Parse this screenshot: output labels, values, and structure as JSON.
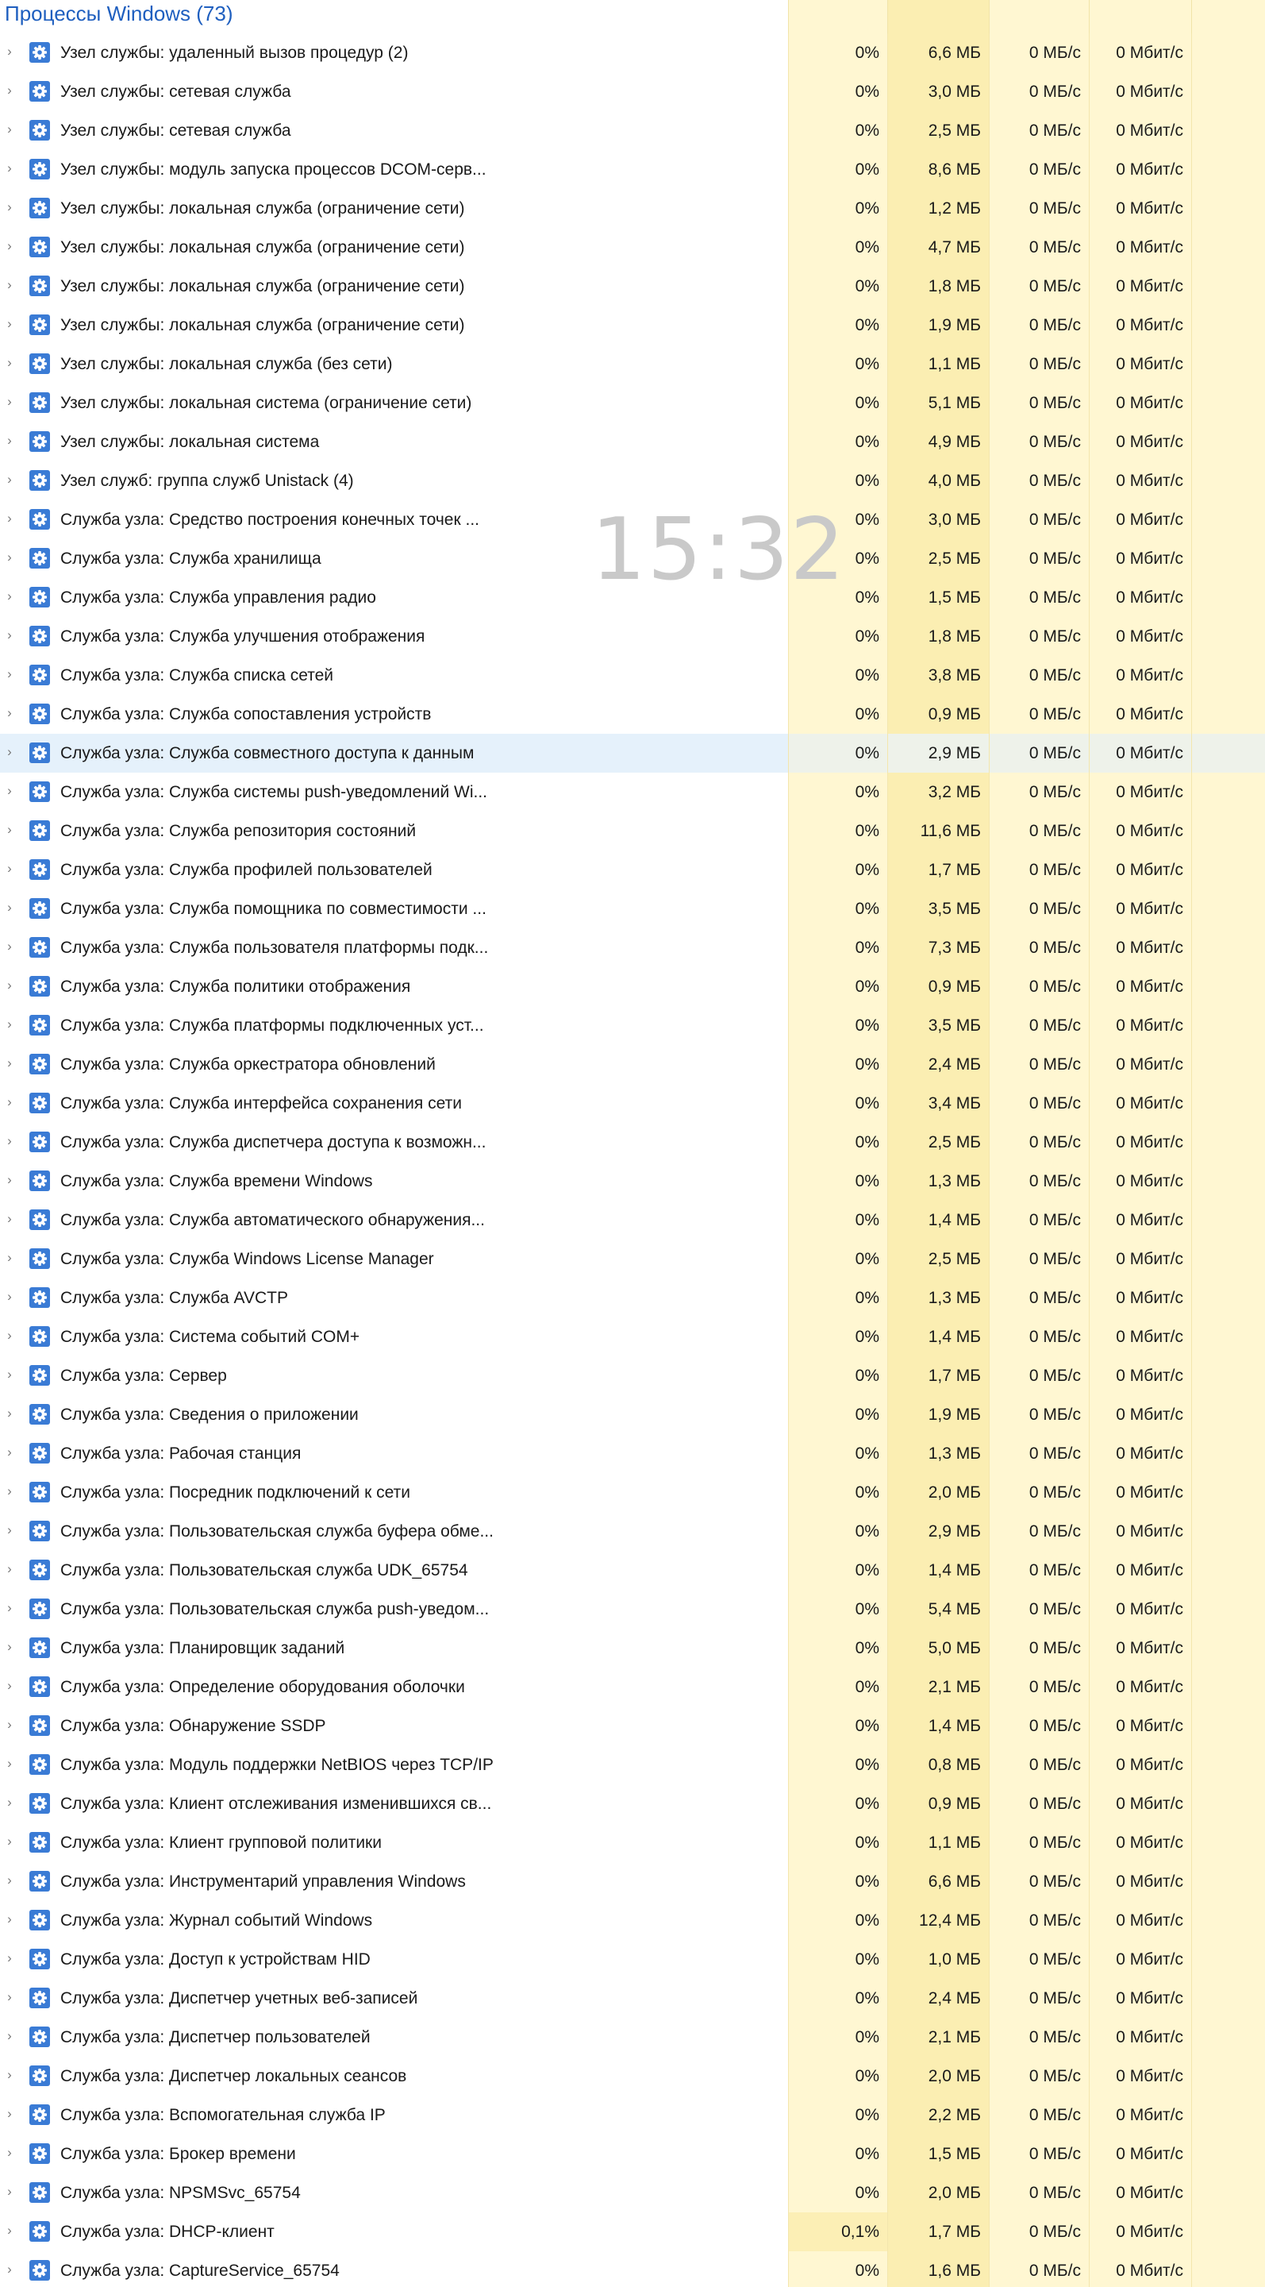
{
  "group_title": "Процессы Windows (73)",
  "clock": "15:32",
  "colors": {
    "group_title": "#1f5fbf",
    "column_bg": "#fff7d2",
    "memory_bg": "#fbeeb2",
    "selected_row": "#e5f1fb"
  },
  "icons": {
    "expand": "chevron-right-icon",
    "process": "gear-icon"
  },
  "selected_row": 18,
  "rows": [
    {
      "name": "Узел службы: удаленный вызов процедур (2)",
      "cpu": "0%",
      "memory": "6,6 МБ",
      "disk": "0 МБ/с",
      "network": "0 Мбит/с"
    },
    {
      "name": "Узел службы: сетевая служба",
      "cpu": "0%",
      "memory": "3,0 МБ",
      "disk": "0 МБ/с",
      "network": "0 Мбит/с"
    },
    {
      "name": "Узел службы: сетевая служба",
      "cpu": "0%",
      "memory": "2,5 МБ",
      "disk": "0 МБ/с",
      "network": "0 Мбит/с"
    },
    {
      "name": "Узел службы: модуль запуска процессов DCOM-серв...",
      "cpu": "0%",
      "memory": "8,6 МБ",
      "disk": "0 МБ/с",
      "network": "0 Мбит/с"
    },
    {
      "name": "Узел службы: локальная служба (ограничение сети)",
      "cpu": "0%",
      "memory": "1,2 МБ",
      "disk": "0 МБ/с",
      "network": "0 Мбит/с"
    },
    {
      "name": "Узел службы: локальная служба (ограничение сети)",
      "cpu": "0%",
      "memory": "4,7 МБ",
      "disk": "0 МБ/с",
      "network": "0 Мбит/с"
    },
    {
      "name": "Узел службы: локальная служба (ограничение сети)",
      "cpu": "0%",
      "memory": "1,8 МБ",
      "disk": "0 МБ/с",
      "network": "0 Мбит/с"
    },
    {
      "name": "Узел службы: локальная служба (ограничение сети)",
      "cpu": "0%",
      "memory": "1,9 МБ",
      "disk": "0 МБ/с",
      "network": "0 Мбит/с"
    },
    {
      "name": "Узел службы: локальная служба (без сети)",
      "cpu": "0%",
      "memory": "1,1 МБ",
      "disk": "0 МБ/с",
      "network": "0 Мбит/с"
    },
    {
      "name": "Узел службы: локальная система (ограничение сети)",
      "cpu": "0%",
      "memory": "5,1 МБ",
      "disk": "0 МБ/с",
      "network": "0 Мбит/с"
    },
    {
      "name": "Узел службы: локальная система",
      "cpu": "0%",
      "memory": "4,9 МБ",
      "disk": "0 МБ/с",
      "network": "0 Мбит/с"
    },
    {
      "name": "Узел служб: группа служб Unistack (4)",
      "cpu": "0%",
      "memory": "4,0 МБ",
      "disk": "0 МБ/с",
      "network": "0 Мбит/с"
    },
    {
      "name": "Служба узла: Средство построения конечных точек ...",
      "cpu": "0%",
      "memory": "3,0 МБ",
      "disk": "0 МБ/с",
      "network": "0 Мбит/с"
    },
    {
      "name": "Служба узла: Служба хранилища",
      "cpu": "0%",
      "memory": "2,5 МБ",
      "disk": "0 МБ/с",
      "network": "0 Мбит/с"
    },
    {
      "name": "Служба узла: Служба управления радио",
      "cpu": "0%",
      "memory": "1,5 МБ",
      "disk": "0 МБ/с",
      "network": "0 Мбит/с"
    },
    {
      "name": "Служба узла: Служба улучшения отображения",
      "cpu": "0%",
      "memory": "1,8 МБ",
      "disk": "0 МБ/с",
      "network": "0 Мбит/с"
    },
    {
      "name": "Служба узла: Служба списка сетей",
      "cpu": "0%",
      "memory": "3,8 МБ",
      "disk": "0 МБ/с",
      "network": "0 Мбит/с"
    },
    {
      "name": "Служба узла: Служба сопоставления устройств",
      "cpu": "0%",
      "memory": "0,9 МБ",
      "disk": "0 МБ/с",
      "network": "0 Мбит/с"
    },
    {
      "name": "Служба узла: Служба совместного доступа к данным",
      "cpu": "0%",
      "memory": "2,9 МБ",
      "disk": "0 МБ/с",
      "network": "0 Мбит/с"
    },
    {
      "name": "Служба узла: Служба системы push-уведомлений Wi...",
      "cpu": "0%",
      "memory": "3,2 МБ",
      "disk": "0 МБ/с",
      "network": "0 Мбит/с"
    },
    {
      "name": "Служба узла: Служба репозитория состояний",
      "cpu": "0%",
      "memory": "11,6 МБ",
      "disk": "0 МБ/с",
      "network": "0 Мбит/с"
    },
    {
      "name": "Служба узла: Служба профилей пользователей",
      "cpu": "0%",
      "memory": "1,7 МБ",
      "disk": "0 МБ/с",
      "network": "0 Мбит/с"
    },
    {
      "name": "Служба узла: Служба помощника по совместимости ...",
      "cpu": "0%",
      "memory": "3,5 МБ",
      "disk": "0 МБ/с",
      "network": "0 Мбит/с"
    },
    {
      "name": "Служба узла: Служба пользователя платформы подк...",
      "cpu": "0%",
      "memory": "7,3 МБ",
      "disk": "0 МБ/с",
      "network": "0 Мбит/с"
    },
    {
      "name": "Служба узла: Служба политики отображения",
      "cpu": "0%",
      "memory": "0,9 МБ",
      "disk": "0 МБ/с",
      "network": "0 Мбит/с"
    },
    {
      "name": "Служба узла: Служба платформы подключенных уст...",
      "cpu": "0%",
      "memory": "3,5 МБ",
      "disk": "0 МБ/с",
      "network": "0 Мбит/с"
    },
    {
      "name": "Служба узла: Служба оркестратора обновлений",
      "cpu": "0%",
      "memory": "2,4 МБ",
      "disk": "0 МБ/с",
      "network": "0 Мбит/с"
    },
    {
      "name": "Служба узла: Служба интерфейса сохранения сети",
      "cpu": "0%",
      "memory": "3,4 МБ",
      "disk": "0 МБ/с",
      "network": "0 Мбит/с"
    },
    {
      "name": "Служба узла: Служба диспетчера доступа к возможн...",
      "cpu": "0%",
      "memory": "2,5 МБ",
      "disk": "0 МБ/с",
      "network": "0 Мбит/с"
    },
    {
      "name": "Служба узла: Служба времени Windows",
      "cpu": "0%",
      "memory": "1,3 МБ",
      "disk": "0 МБ/с",
      "network": "0 Мбит/с"
    },
    {
      "name": "Служба узла: Служба автоматического обнаружения...",
      "cpu": "0%",
      "memory": "1,4 МБ",
      "disk": "0 МБ/с",
      "network": "0 Мбит/с"
    },
    {
      "name": "Служба узла: Служба Windows License Manager",
      "cpu": "0%",
      "memory": "2,5 МБ",
      "disk": "0 МБ/с",
      "network": "0 Мбит/с"
    },
    {
      "name": "Служба узла: Служба AVCTP",
      "cpu": "0%",
      "memory": "1,3 МБ",
      "disk": "0 МБ/с",
      "network": "0 Мбит/с"
    },
    {
      "name": "Служба узла: Система событий COM+",
      "cpu": "0%",
      "memory": "1,4 МБ",
      "disk": "0 МБ/с",
      "network": "0 Мбит/с"
    },
    {
      "name": "Служба узла: Сервер",
      "cpu": "0%",
      "memory": "1,7 МБ",
      "disk": "0 МБ/с",
      "network": "0 Мбит/с"
    },
    {
      "name": "Служба узла: Сведения о приложении",
      "cpu": "0%",
      "memory": "1,9 МБ",
      "disk": "0 МБ/с",
      "network": "0 Мбит/с"
    },
    {
      "name": "Служба узла: Рабочая станция",
      "cpu": "0%",
      "memory": "1,3 МБ",
      "disk": "0 МБ/с",
      "network": "0 Мбит/с"
    },
    {
      "name": "Служба узла: Посредник подключений к сети",
      "cpu": "0%",
      "memory": "2,0 МБ",
      "disk": "0 МБ/с",
      "network": "0 Мбит/с"
    },
    {
      "name": "Служба узла: Пользовательская служба буфера обме...",
      "cpu": "0%",
      "memory": "2,9 МБ",
      "disk": "0 МБ/с",
      "network": "0 Мбит/с"
    },
    {
      "name": "Служба узла: Пользовательская служба UDK_65754",
      "cpu": "0%",
      "memory": "1,4 МБ",
      "disk": "0 МБ/с",
      "network": "0 Мбит/с"
    },
    {
      "name": "Служба узла: Пользовательская служба push-уведом...",
      "cpu": "0%",
      "memory": "5,4 МБ",
      "disk": "0 МБ/с",
      "network": "0 Мбит/с"
    },
    {
      "name": "Служба узла: Планировщик заданий",
      "cpu": "0%",
      "memory": "5,0 МБ",
      "disk": "0 МБ/с",
      "network": "0 Мбит/с"
    },
    {
      "name": "Служба узла: Определение оборудования оболочки",
      "cpu": "0%",
      "memory": "2,1 МБ",
      "disk": "0 МБ/с",
      "network": "0 Мбит/с"
    },
    {
      "name": "Служба узла: Обнаружение SSDP",
      "cpu": "0%",
      "memory": "1,4 МБ",
      "disk": "0 МБ/с",
      "network": "0 Мбит/с"
    },
    {
      "name": "Служба узла: Модуль поддержки NetBIOS через TCP/IP",
      "cpu": "0%",
      "memory": "0,8 МБ",
      "disk": "0 МБ/с",
      "network": "0 Мбит/с"
    },
    {
      "name": "Служба узла: Клиент отслеживания изменившихся св...",
      "cpu": "0%",
      "memory": "0,9 МБ",
      "disk": "0 МБ/с",
      "network": "0 Мбит/с"
    },
    {
      "name": "Служба узла: Клиент групповой политики",
      "cpu": "0%",
      "memory": "1,1 МБ",
      "disk": "0 МБ/с",
      "network": "0 Мбит/с"
    },
    {
      "name": "Служба узла: Инструментарий управления Windows",
      "cpu": "0%",
      "memory": "6,6 МБ",
      "disk": "0 МБ/с",
      "network": "0 Мбит/с"
    },
    {
      "name": "Служба узла: Журнал событий Windows",
      "cpu": "0%",
      "memory": "12,4 МБ",
      "disk": "0 МБ/с",
      "network": "0 Мбит/с"
    },
    {
      "name": "Служба узла: Доступ к устройствам HID",
      "cpu": "0%",
      "memory": "1,0 МБ",
      "disk": "0 МБ/с",
      "network": "0 Мбит/с"
    },
    {
      "name": "Служба узла: Диспетчер учетных веб-записей",
      "cpu": "0%",
      "memory": "2,4 МБ",
      "disk": "0 МБ/с",
      "network": "0 Мбит/с"
    },
    {
      "name": "Служба узла: Диспетчер пользователей",
      "cpu": "0%",
      "memory": "2,1 МБ",
      "disk": "0 МБ/с",
      "network": "0 Мбит/с"
    },
    {
      "name": "Служба узла: Диспетчер локальных сеансов",
      "cpu": "0%",
      "memory": "2,0 МБ",
      "disk": "0 МБ/с",
      "network": "0 Мбит/с"
    },
    {
      "name": "Служба узла: Вспомогательная служба IP",
      "cpu": "0%",
      "memory": "2,2 МБ",
      "disk": "0 МБ/с",
      "network": "0 Мбит/с"
    },
    {
      "name": "Служба узла: Брокер времени",
      "cpu": "0%",
      "memory": "1,5 МБ",
      "disk": "0 МБ/с",
      "network": "0 Мбит/с"
    },
    {
      "name": "Служба узла: NPSMSvc_65754",
      "cpu": "0%",
      "memory": "2,0 МБ",
      "disk": "0 МБ/с",
      "network": "0 Мбит/с"
    },
    {
      "name": "Служба узла: DHCP-клиент",
      "cpu": "0,1%",
      "memory": "1,7 МБ",
      "disk": "0 МБ/с",
      "network": "0 Мбит/с"
    },
    {
      "name": "Служба узла: CaptureService_65754",
      "cpu": "0%",
      "memory": "1,6 МБ",
      "disk": "0 МБ/с",
      "network": "0 Мбит/с"
    }
  ]
}
